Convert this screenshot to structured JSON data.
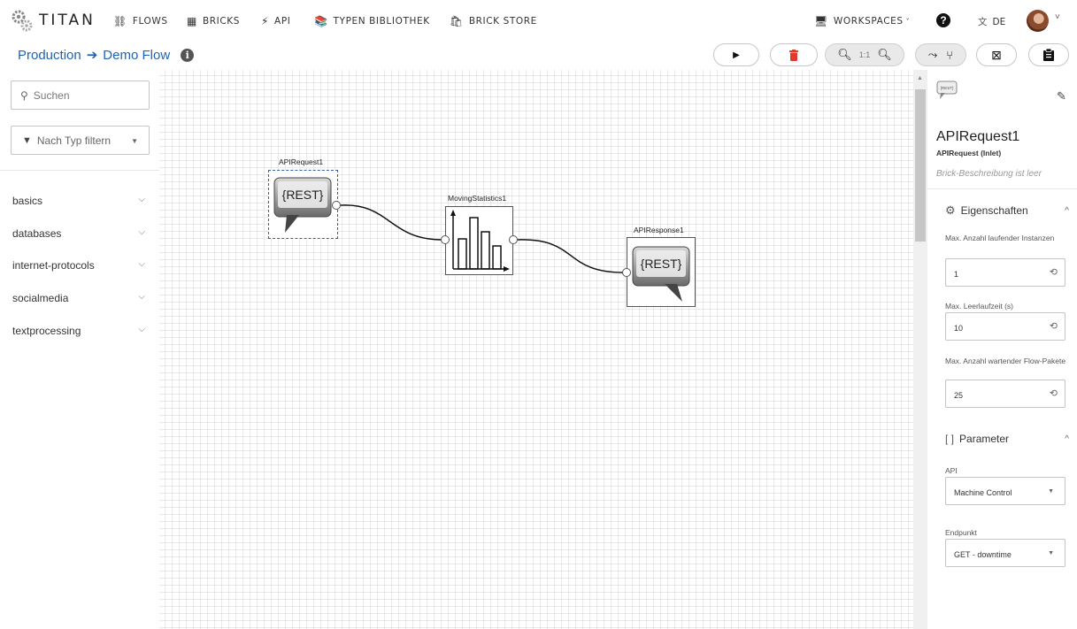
{
  "app": {
    "title": "TITAN",
    "nav": [
      {
        "label": "FLOWS",
        "icon": "flows-icon"
      },
      {
        "label": "BRICKS",
        "icon": "bricks-icon"
      },
      {
        "label": "API",
        "icon": "api-icon"
      },
      {
        "label": "TYPEN BIBLIOTHEK",
        "icon": "library-icon"
      },
      {
        "label": "BRICK STORE",
        "icon": "store-icon"
      }
    ],
    "workspaces_label": "WORKSPACES",
    "language": "DE"
  },
  "breadcrumb": {
    "parent": "Production",
    "current": "Demo Flow"
  },
  "toolbar": {
    "zoom_reset": "1:1"
  },
  "sidebar": {
    "search_placeholder": "Suchen",
    "filter_label": "Nach Typ filtern",
    "categories": [
      "basics",
      "databases",
      "internet-protocols",
      "socialmedia",
      "textprocessing"
    ]
  },
  "canvas": {
    "nodes": [
      {
        "name": "APIRequest1",
        "text": "{REST}"
      },
      {
        "name": "MovingStatistics1"
      },
      {
        "name": "APIResponse1",
        "text": "{REST}"
      }
    ]
  },
  "details": {
    "title": "APIRequest1",
    "subtitle": "APIRequest (Inlet)",
    "description": "Brick-Beschreibung ist leer",
    "properties_header": "Eigenschaften",
    "fields": [
      {
        "label": "Max. Anzahl laufender Instanzen",
        "value": "1"
      },
      {
        "label": "Max. Leerlaufzeit (s)",
        "value": "10"
      },
      {
        "label": "Max. Anzahl wartender Flow-Pakete",
        "value": "25"
      }
    ],
    "parameters_header": "Parameter",
    "api_label": "API",
    "api_value": "Machine Control",
    "endpoint_label": "Endpunkt",
    "endpoint_value": "GET - downtime"
  },
  "colors": {
    "link": "#1e63b5",
    "delete": "#e03a2f"
  }
}
